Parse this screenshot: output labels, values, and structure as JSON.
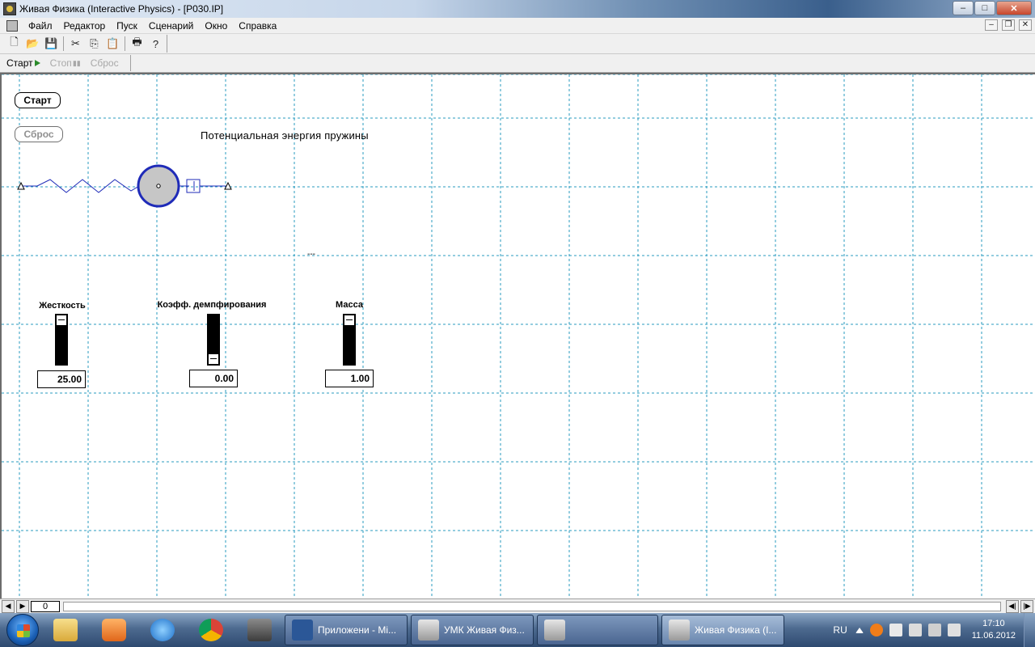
{
  "window": {
    "title": "Живая Физика (Interactive Physics) - [P030.IP]",
    "minimize": "–",
    "maximize": "□",
    "close": "✕"
  },
  "menu": {
    "items": [
      "Файл",
      "Редактор",
      "Пуск",
      "Сценарий",
      "Окно",
      "Справка"
    ],
    "mdi_min": "–",
    "mdi_restore": "❐",
    "mdi_close": "✕"
  },
  "toolbar": {
    "new": "🗋",
    "open": "📂",
    "save": "💾",
    "cut": "✂",
    "copy": "⎘",
    "paste": "📋",
    "print": "🖶",
    "help": "?"
  },
  "runbar": {
    "start": "Старт",
    "stop": "Стоп",
    "stop_glyph": "▮▮",
    "reset": "Сброс"
  },
  "workspace": {
    "start_button": "Старт",
    "reset_button": "Сброс",
    "scene_title": "Потенциальная энергия пружины",
    "meter_placeholder": "---",
    "sliders": [
      {
        "label": "Жесткость",
        "value": "25.00",
        "fraction": 1.0
      },
      {
        "label": "Коэфф. демпфирования",
        "value": "0.00",
        "fraction": 0.0
      },
      {
        "label": "Масса",
        "value": "1.00",
        "fraction": 1.0
      }
    ]
  },
  "scrollbar": {
    "back": "◀",
    "forward": "▶",
    "frame": "0",
    "left_end": "◀|",
    "right_end": "|▶"
  },
  "taskbar": {
    "tasks": [
      {
        "label": "Приложени - Mi...",
        "icon_color": "#2b5797"
      },
      {
        "label": "УМК Живая Физ...",
        "icon_color": "#c9c9c9"
      },
      {
        "label": "",
        "icon_color": "#c9c9c9"
      },
      {
        "label": "Живая Физика (I...",
        "icon_color": "#c9c9c9"
      }
    ],
    "language": "RU",
    "time": "17:10",
    "date": "11.06.2012"
  },
  "colors": {
    "grid": "#2a9bbf",
    "ball_fill": "#c6c6c6",
    "ball_stroke": "#1f2bb8",
    "spring": "#1f2bb8"
  }
}
